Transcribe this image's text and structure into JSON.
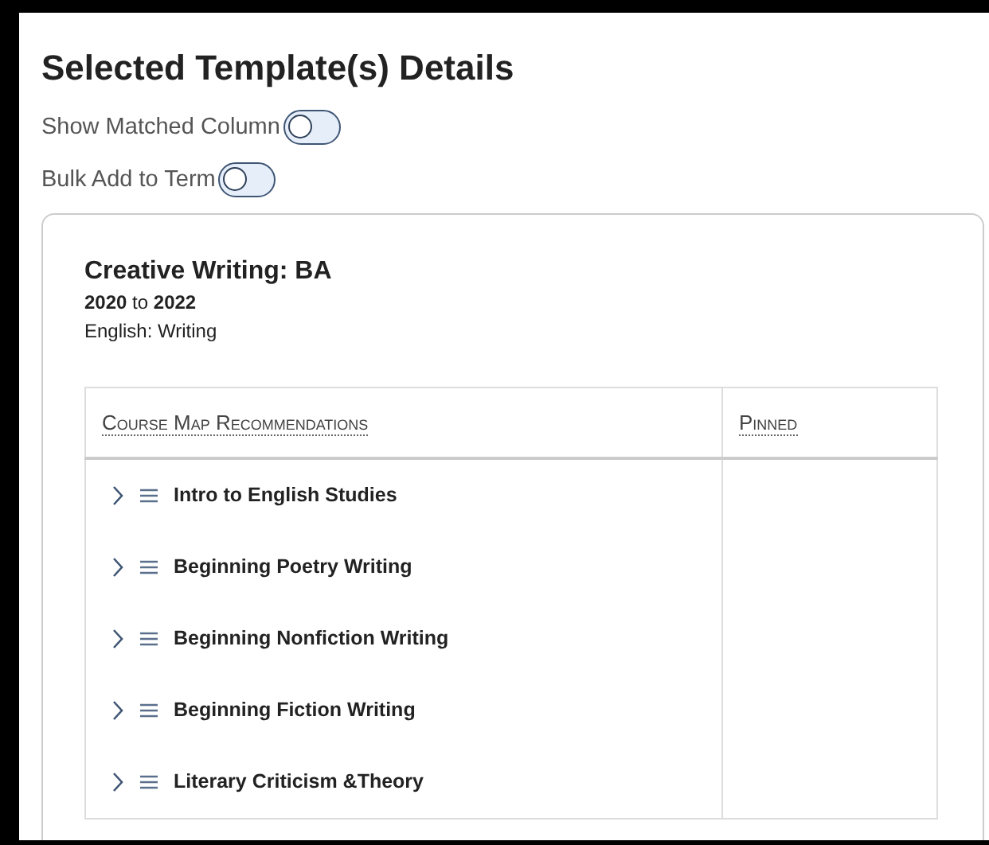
{
  "heading": "Selected Template(s) Details",
  "toggles": [
    {
      "label": "Show Matched Column",
      "on": false
    },
    {
      "label": "Bulk Add to Term",
      "on": false
    }
  ],
  "template": {
    "title": "Creative Writing: BA",
    "years": "**2020** to **2022**",
    "subtitle": "English: Writing"
  },
  "table": {
    "columns": [
      "Course Map Recommendations",
      "Pinned"
    ],
    "rows": [
      {
        "course": "Intro to English Studies",
        "expanded": false
      },
      {
        "course": "Beginning Poetry Writing",
        "expanded": false
      },
      {
        "course": "Beginning Nonfiction Writing",
        "expanded": false
      },
      {
        "course": "Beginning Fiction Writing",
        "expanded": false
      },
      {
        "course": "Literary Criticism &Theory",
        "expanded": false
      }
    ]
  }
}
